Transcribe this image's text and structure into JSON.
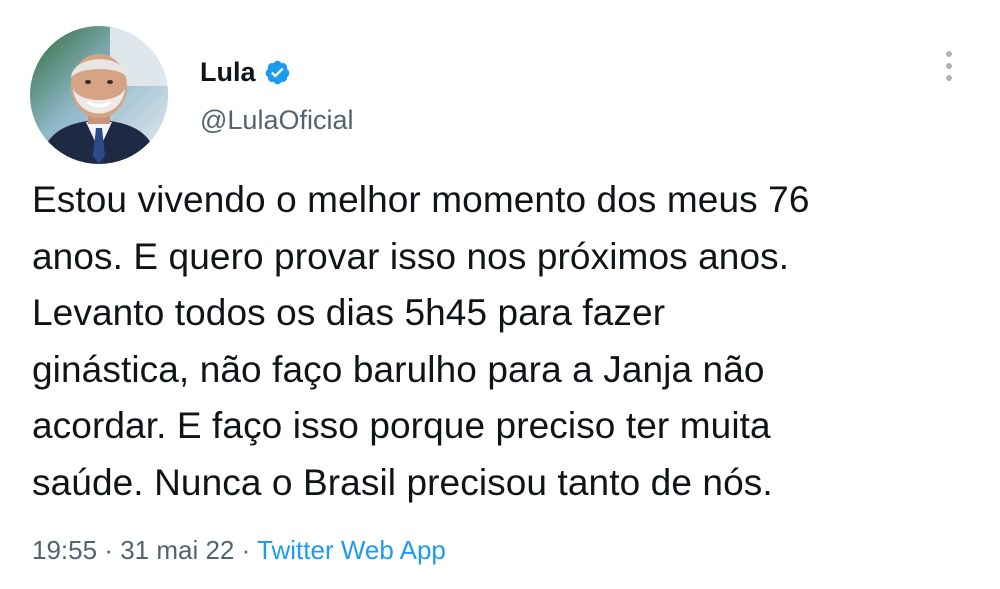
{
  "author": {
    "display_name": "Lula",
    "handle": "@LulaOficial",
    "verified": true,
    "avatar_icon": "profile-photo"
  },
  "tweet": {
    "lines": [
      "Estou vivendo o melhor momento dos meus 76",
      "anos. E quero provar isso nos próximos anos.",
      "Levanto todos os dias 5h45 para fazer",
      "ginástica, não faço barulho para a Janja não",
      "acordar. E faço isso porque preciso ter muita",
      "saúde. Nunca o Brasil precisou tanto de nós."
    ]
  },
  "meta": {
    "time": "19:55",
    "separator": "·",
    "date": "31 mai 22",
    "source": "Twitter Web App"
  },
  "colors": {
    "verified": "#1d9bf0",
    "link": "#1d9bf0",
    "secondary_text": "#536471"
  },
  "icons": {
    "more": "more-vertical-icon",
    "verified": "verified-badge-icon"
  }
}
